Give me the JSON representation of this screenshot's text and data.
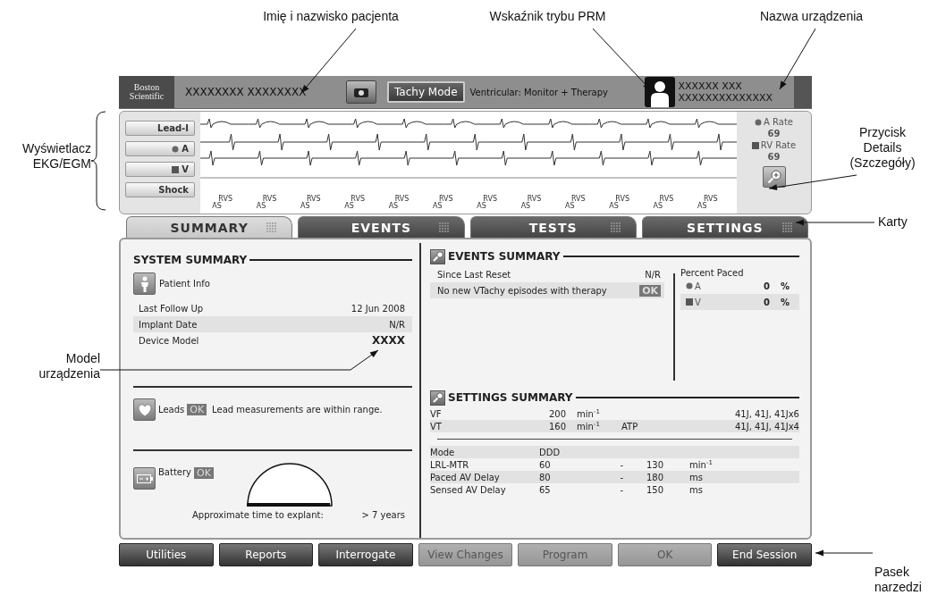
{
  "annotations": [
    {
      "text": "Imię i nazwisko pacjenta"
    },
    {
      "text": "Wskaźnik trybu PRM"
    },
    {
      "text": "Nazwa urządzenia"
    },
    {
      "text": "Wyświetlacz EKG/EGM"
    },
    {
      "text": "Przycisk Details (Szczegóły)"
    },
    {
      "text": "Karty"
    },
    {
      "text": "Model urządzenia"
    },
    {
      "text": "Pasek narzedzi"
    }
  ],
  "header": {
    "logo_lines": [
      "Boston",
      "Scientific"
    ],
    "patient_name": "XXXXXXXX XXXXXXXX",
    "mode_button": "Tachy Mode",
    "mode_text": "Ventricular: Monitor + Therapy",
    "device_name_lines": [
      "XXXXXX XXX",
      "XXXXXXXXXXXXXX"
    ]
  },
  "ecg": {
    "channels": [
      {
        "kind": "text",
        "label": "Lead-I"
      },
      {
        "kind": "dot",
        "label": "A"
      },
      {
        "kind": "square",
        "label": "V"
      },
      {
        "kind": "text",
        "label": "Shock"
      }
    ],
    "markers": [
      {
        "upper": "RVS",
        "lower": "AS"
      },
      {
        "upper": "RVS",
        "lower": "AS"
      },
      {
        "upper": "RVS",
        "lower": "AS"
      },
      {
        "upper": "RVS",
        "lower": "AS"
      },
      {
        "upper": "RVS",
        "lower": "AS"
      },
      {
        "upper": "RVS",
        "lower": "AS"
      },
      {
        "upper": "RVS",
        "lower": "AS"
      },
      {
        "upper": "RVS",
        "lower": "AS"
      },
      {
        "upper": "RVS",
        "lower": "AS"
      },
      {
        "upper": "RVS",
        "lower": "AS"
      },
      {
        "upper": "RVS",
        "lower": "AS"
      },
      {
        "upper": "RVS",
        "lower": "AS"
      }
    ],
    "rates": [
      {
        "kind": "dot",
        "label": "A Rate",
        "value": "69"
      },
      {
        "kind": "square",
        "label": "RV Rate",
        "value": "69"
      }
    ]
  },
  "tabs": [
    {
      "label": "SUMMARY",
      "selected": true
    },
    {
      "label": "EVENTS",
      "selected": false
    },
    {
      "label": "TESTS",
      "selected": false
    },
    {
      "label": "SETTINGS",
      "selected": false
    }
  ],
  "system_summary": {
    "title": "SYSTEM SUMMARY",
    "patient_info": "Patient Info",
    "rows": [
      {
        "label": "Last Follow Up",
        "value": "12 Jun 2008"
      },
      {
        "label": "Implant Date",
        "value": "N/R"
      },
      {
        "label": "Device Model",
        "value": "XXXX"
      }
    ],
    "leads": {
      "label": "Leads",
      "status": "OK",
      "message": "Lead measurements are within range."
    },
    "battery": {
      "label": "Battery",
      "status": "OK",
      "level": 0.97,
      "explant_label": "Approximate time to explant:",
      "explant_value": "> 7 years"
    }
  },
  "events_summary": {
    "title": "EVENTS SUMMARY",
    "rows": [
      {
        "label": "Since Last Reset",
        "value": "N/R",
        "kind": "text"
      },
      {
        "label": "No new VTachy episodes with therapy",
        "value": "OK",
        "kind": "badge"
      }
    ],
    "percent_paced": {
      "title": "Percent Paced",
      "rows": [
        {
          "kind": "dot",
          "label": "A",
          "value": "0",
          "unit": "%"
        },
        {
          "kind": "square",
          "label": "V",
          "value": "0",
          "unit": "%"
        }
      ]
    }
  },
  "settings_summary": {
    "title": "SETTINGS SUMMARY",
    "zones": [
      {
        "name": "VF",
        "rate": "200",
        "unit": "min$^{-1}$",
        "shocks": "41J, 41J, 41Jx6"
      },
      {
        "name": "VT",
        "rate": "160",
        "unit": "min$^{-1}$",
        "therapy": "ATP",
        "shocks": "41J, 41J, 41Jx4"
      }
    ],
    "params": [
      {
        "name": "Mode",
        "low": "DDD"
      },
      {
        "name": "LRL-MTR",
        "low": "60",
        "dash": "-",
        "high": "130",
        "unit": "min$^{-1}$"
      },
      {
        "name": "Paced AV Delay",
        "low": "80",
        "dash": "-",
        "high": "180",
        "unit": "ms"
      },
      {
        "name": "Sensed AV Delay",
        "low": "65",
        "dash": "-",
        "high": "150",
        "unit": "ms"
      }
    ]
  },
  "toolbar": [
    {
      "label": "Utilities",
      "disabled": false
    },
    {
      "label": "Reports",
      "disabled": false
    },
    {
      "label": "Interrogate",
      "disabled": false
    },
    {
      "label": "View Changes",
      "disabled": true
    },
    {
      "label": "Program",
      "disabled": true
    },
    {
      "label": "OK",
      "disabled": true
    },
    {
      "label": "End Session",
      "disabled": false
    }
  ]
}
